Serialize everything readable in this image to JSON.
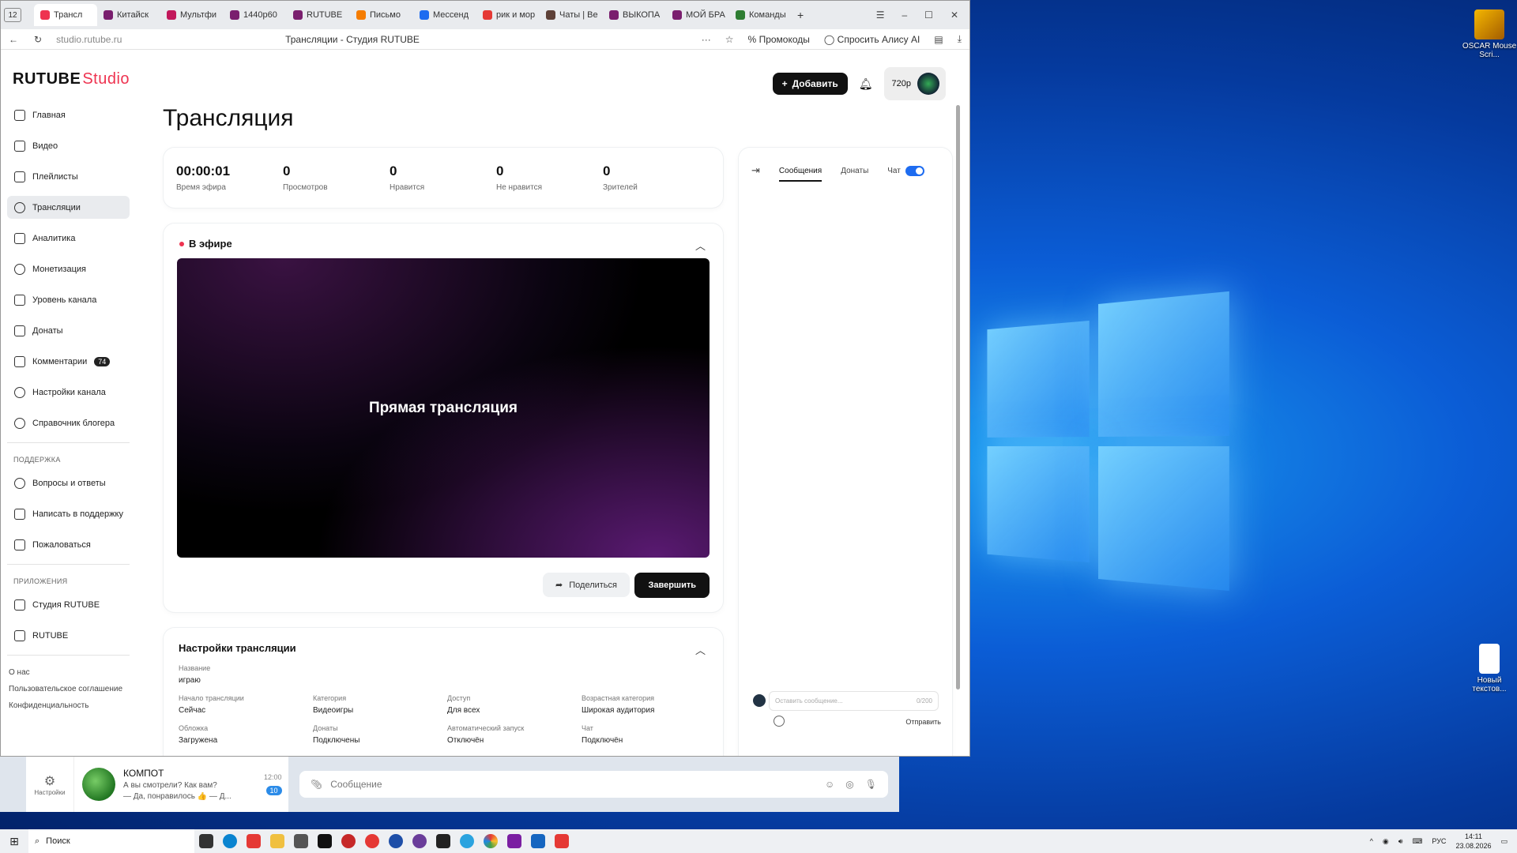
{
  "browser": {
    "tab_count": "12",
    "tabs": [
      {
        "label": "Трансл",
        "color": "#ee3350"
      },
      {
        "label": "Китайск",
        "color": "#7a1f6e"
      },
      {
        "label": "Мультфи",
        "color": "#c2185b"
      },
      {
        "label": "1440p60",
        "color": "#7a1f6e"
      },
      {
        "label": "RUTUBE",
        "color": "#7a1f6e"
      },
      {
        "label": "Письмо",
        "color": "#f57c00"
      },
      {
        "label": "Мессенд",
        "color": "#1e6cf0"
      },
      {
        "label": "рик и мор",
        "color": "#e53935"
      },
      {
        "label": "Чаты | Ве",
        "color": "#5d4037"
      },
      {
        "label": "ВЫКОПА",
        "color": "#7a1f6e"
      },
      {
        "label": "МОЙ БРА",
        "color": "#7a1f6e"
      },
      {
        "label": "Команды",
        "color": "#2e7d32"
      }
    ],
    "url": "studio.rutube.ru",
    "page_title": "Трансляции - Студия RUTUBE",
    "promo": "Промокоды",
    "alice": "Спросить Алису AI"
  },
  "studio": {
    "logo_main": "RUTUBE",
    "logo_sub": "Studio",
    "add_button": "Добавить",
    "quality": "720p",
    "heading": "Трансляция"
  },
  "sidebar": {
    "items": [
      {
        "label": "Главная"
      },
      {
        "label": "Видео"
      },
      {
        "label": "Плейлисты"
      },
      {
        "label": "Трансляции"
      },
      {
        "label": "Аналитика"
      },
      {
        "label": "Монетизация"
      },
      {
        "label": "Уровень канала"
      },
      {
        "label": "Донаты"
      },
      {
        "label": "Комментарии",
        "badge": "74"
      },
      {
        "label": "Настройки канала"
      },
      {
        "label": "Справочник блогера"
      }
    ],
    "support_title": "ПОДДЕРЖКА",
    "support_items": [
      "Вопросы и ответы",
      "Написать в поддержку",
      "Пожаловаться"
    ],
    "apps_title": "ПРИЛОЖЕНИЯ",
    "apps_items": [
      "Студия RUTUBE",
      "RUTUBE"
    ],
    "footer": [
      "О нас",
      "Пользовательское соглашение",
      "Конфиденциальность"
    ]
  },
  "stats": [
    {
      "value": "00:00:01",
      "label": "Время эфира"
    },
    {
      "value": "0",
      "label": "Просмотров"
    },
    {
      "value": "0",
      "label": "Нравится"
    },
    {
      "value": "0",
      "label": "Не нравится"
    },
    {
      "value": "0",
      "label": "Зрителей"
    }
  ],
  "live": {
    "status": "В эфире",
    "player_text": "Прямая трансляция",
    "share": "Поделиться",
    "end": "Завершить"
  },
  "settings": {
    "title": "Настройки трансляции",
    "name_label": "Название",
    "name_value": "играю",
    "fields": [
      {
        "label": "Начало трансляции",
        "value": "Сейчас"
      },
      {
        "label": "Категория",
        "value": "Видеоигры"
      },
      {
        "label": "Доступ",
        "value": "Для всех"
      },
      {
        "label": "Возрастная категория",
        "value": "Широкая аудитория"
      },
      {
        "label": "Обложка",
        "value": "Загружена"
      },
      {
        "label": "Донаты",
        "value": "Подключены"
      },
      {
        "label": "Автоматический запуск",
        "value": "Отключён"
      },
      {
        "label": "Чат",
        "value": "Подключён"
      }
    ]
  },
  "chat": {
    "tab_messages": "Сообщения",
    "tab_donates": "Донаты",
    "chat_label": "Чат",
    "input_placeholder": "Оставить сообщение...",
    "counter": "0/200",
    "send": "Отправить"
  },
  "desktop": {
    "icon1": "OSCAR Mouse Scri...",
    "icon2": "Новый текстов..."
  },
  "messenger": {
    "settings_label": "Настройки",
    "chat_name": "КОМПОТ",
    "line1": "А вы смотрели? Как вам?",
    "line2": "— Да, понравилось 👍 — Д...",
    "time": "12:00",
    "unread": "10",
    "input_placeholder": "Сообщение"
  },
  "taskbar": {
    "search": "Поиск",
    "lang": "РУС",
    "time": "14:11",
    "date": "23.08.2026"
  }
}
